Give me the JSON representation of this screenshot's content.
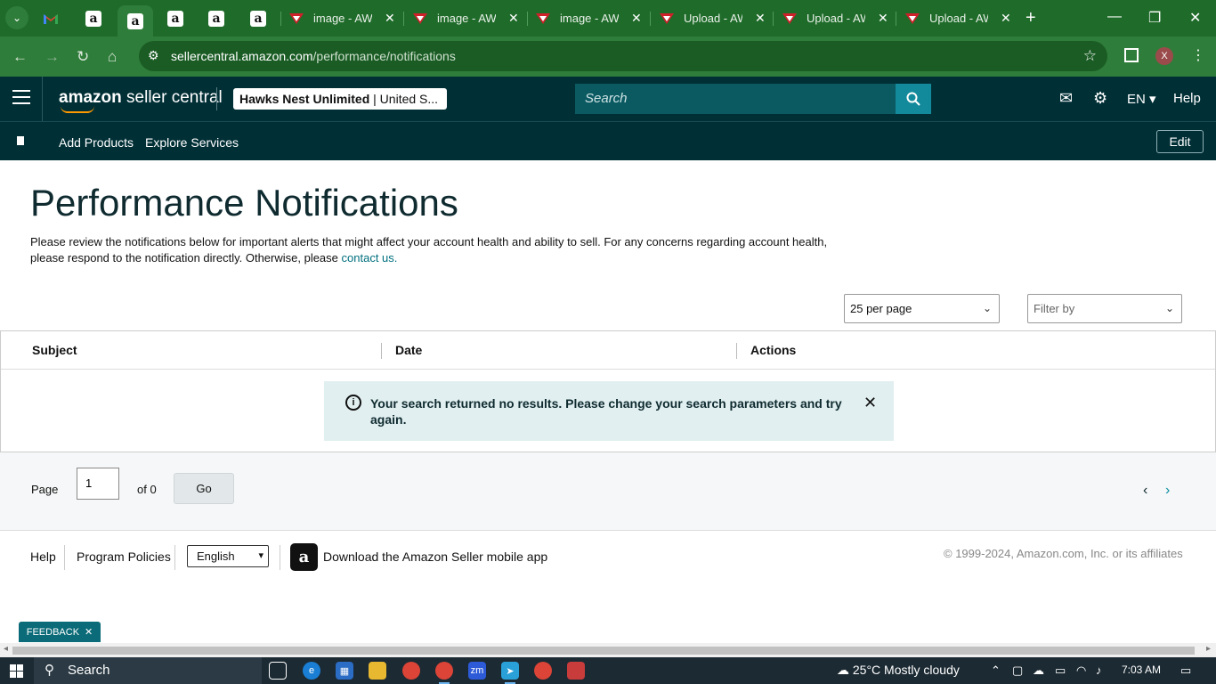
{
  "browser": {
    "tabs": [
      {
        "icon": "gmail-icon",
        "title": ""
      },
      {
        "icon": "amazon-icon",
        "title": ""
      },
      {
        "icon": "amazon-icon",
        "title": "",
        "active": true
      },
      {
        "icon": "amazon-icon",
        "title": ""
      },
      {
        "icon": "amazon-icon",
        "title": ""
      },
      {
        "icon": "amazon-icon",
        "title": ""
      },
      {
        "icon": "awl-icon",
        "title": "image - AWL"
      },
      {
        "icon": "awl-icon",
        "title": "image - AWL"
      },
      {
        "icon": "awl-icon",
        "title": "image - AWL"
      },
      {
        "icon": "awl-icon",
        "title": "Upload - AW"
      },
      {
        "icon": "awl-icon",
        "title": "Upload - AW"
      },
      {
        "icon": "awl-icon",
        "title": "Upload - AW"
      }
    ],
    "url_host": "sellercentral.amazon.com",
    "url_path": "/performance/notifications",
    "profile_initial": "X"
  },
  "header": {
    "logo_bold": "amazon",
    "logo_rest": " seller central",
    "account_name": "Hawks Nest Unlimited",
    "account_region": " | United S...",
    "search_placeholder": "Search",
    "language": "EN",
    "help": "Help"
  },
  "subnav": {
    "links": [
      "Add Products",
      "Explore Services"
    ],
    "edit": "Edit"
  },
  "main": {
    "title": "Performance Notifications",
    "description": "Please review the notifications below for important alerts that might affect your account health and ability to sell. For any concerns regarding account health, please respond to the notification directly. Otherwise, please ",
    "contact_link": "contact us.",
    "per_page": "25 per page",
    "filter_placeholder": "Filter by",
    "columns": [
      "Subject",
      "Date",
      "Actions"
    ],
    "alert_text": "Your search returned no results. Please change your search parameters and try again."
  },
  "pager": {
    "page_label": "Page",
    "page_value": "1",
    "of_label": "of 0",
    "go": "Go"
  },
  "footer": {
    "help": "Help",
    "program_policies": "Program Policies",
    "language": "English",
    "app_text": "Download the Amazon Seller mobile app",
    "copyright": "© 1999-2024, Amazon.com, Inc. or its affiliates"
  },
  "feedback": "FEEDBACK",
  "taskbar": {
    "search": "Search",
    "weather": "25°C  Mostly cloudy",
    "time": "7:03 AM"
  },
  "colors": {
    "chrome_green": "#1f6b2a",
    "header_bg": "#002f36",
    "accent": "#00707f",
    "alert_bg": "#e1eff0"
  }
}
